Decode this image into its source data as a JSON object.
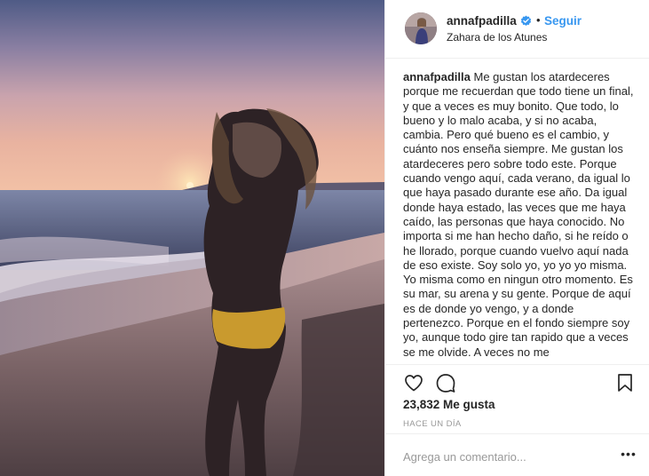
{
  "post": {
    "username": "annafpadilla",
    "follow_label": "Seguir",
    "separator": "•",
    "location": "Zahara de los Atunes",
    "caption_user": "annafpadilla",
    "caption_text": "Me gustan los atardeceres porque me recuerdan que todo tiene un final, y que a veces es muy bonito. Que todo, lo bueno y lo malo acaba, y si no acaba, cambia. Pero qué bueno es el cambio, y cuánto nos enseña siempre. Me gustan los atardeceres pero sobre todo este. Porque cuando vengo aquí, cada verano, da igual lo que haya pasado durante ese año. Da igual donde haya estado, las veces que me haya caído, las personas que haya conocido. No importa si me han hecho daño, si he reído o he llorado, porque cuando vuelvo aquí nada de eso existe. Soy solo yo, yo yo yo misma. Yo misma como en ningun otro momento. Es su mar, su arena y su gente. Porque de aquí es de donde yo vengo, y a donde pertenezco. Porque en el fondo siempre soy yo, aunque todo gire tan rapido que a veces se me olvide. A veces no me",
    "likes": "23,832 Me gusta",
    "time_ago": "HACE UN DÍA",
    "comment_placeholder": "Agrega un comentario...",
    "more_label": "•••"
  },
  "icons": {
    "verified": "verified-badge-icon",
    "like": "heart-icon",
    "comment": "comment-bubble-icon",
    "save": "bookmark-icon",
    "more": "more-options-icon"
  },
  "colors": {
    "link_blue": "#3897f0",
    "text": "#262626",
    "muted": "#999999",
    "divider": "#efefef"
  }
}
